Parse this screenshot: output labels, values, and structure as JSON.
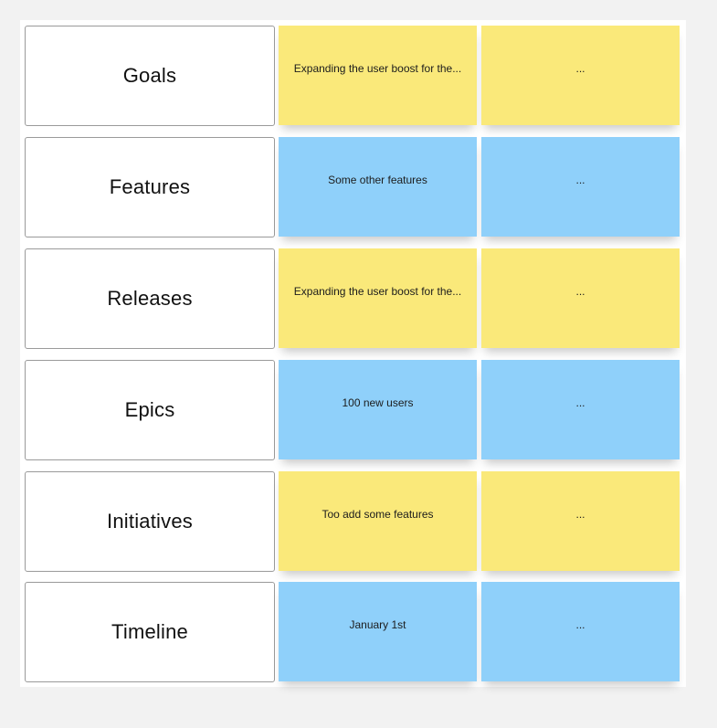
{
  "colors": {
    "background": "#f2f2f2",
    "panel": "#ffffff",
    "yellow_note": "#fae97a",
    "blue_note": "#8fd0fa",
    "label_border": "#9a9a9a"
  },
  "rows": [
    {
      "label": "Goals",
      "color": "yellow",
      "notes": [
        "Expanding the user boost for the...",
        "..."
      ]
    },
    {
      "label": "Features",
      "color": "blue",
      "notes": [
        "Some other features",
        "..."
      ]
    },
    {
      "label": "Releases",
      "color": "yellow",
      "notes": [
        "Expanding the user boost for the...",
        "..."
      ]
    },
    {
      "label": "Epics",
      "color": "blue",
      "notes": [
        "100 new users",
        "..."
      ]
    },
    {
      "label": "Initiatives",
      "color": "yellow",
      "notes": [
        "Too add some features",
        "..."
      ]
    },
    {
      "label": "Timeline",
      "color": "blue",
      "notes": [
        "January 1st",
        "..."
      ]
    }
  ]
}
